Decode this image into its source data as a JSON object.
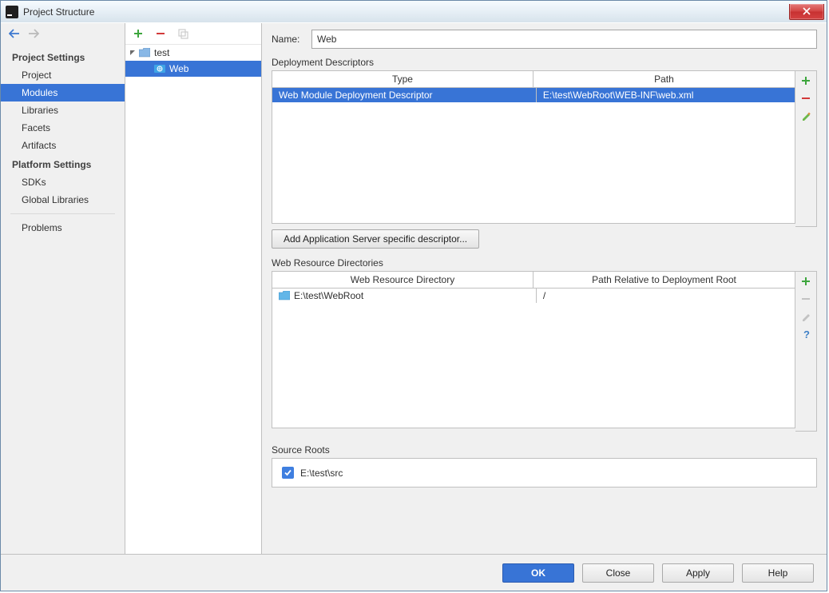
{
  "window": {
    "title": "Project Structure"
  },
  "sidebar": {
    "heading_project": "Project Settings",
    "items_project": [
      {
        "label": "Project"
      },
      {
        "label": "Modules"
      },
      {
        "label": "Libraries"
      },
      {
        "label": "Facets"
      },
      {
        "label": "Artifacts"
      }
    ],
    "heading_platform": "Platform Settings",
    "items_platform": [
      {
        "label": "SDKs"
      },
      {
        "label": "Global Libraries"
      }
    ],
    "items_other": [
      {
        "label": "Problems"
      }
    ]
  },
  "tree": {
    "root": {
      "label": "test"
    },
    "child": {
      "label": "Web"
    }
  },
  "form": {
    "name_label": "Name:",
    "name_value": "Web"
  },
  "deployment": {
    "title": "Deployment Descriptors",
    "headers": {
      "type": "Type",
      "path": "Path"
    },
    "row": {
      "type": "Web Module Deployment Descriptor",
      "path": "E:\\test\\WebRoot\\WEB-INF\\web.xml"
    },
    "button": "Add Application Server specific descriptor..."
  },
  "webres": {
    "title": "Web Resource Directories",
    "headers": {
      "dir": "Web Resource Directory",
      "rel": "Path Relative to Deployment Root"
    },
    "row": {
      "dir": "E:\\test\\WebRoot",
      "rel": "/"
    }
  },
  "source": {
    "title": "Source Roots",
    "item": "E:\\test\\src"
  },
  "buttons": {
    "ok": "OK",
    "close": "Close",
    "apply": "Apply",
    "help": "Help"
  }
}
